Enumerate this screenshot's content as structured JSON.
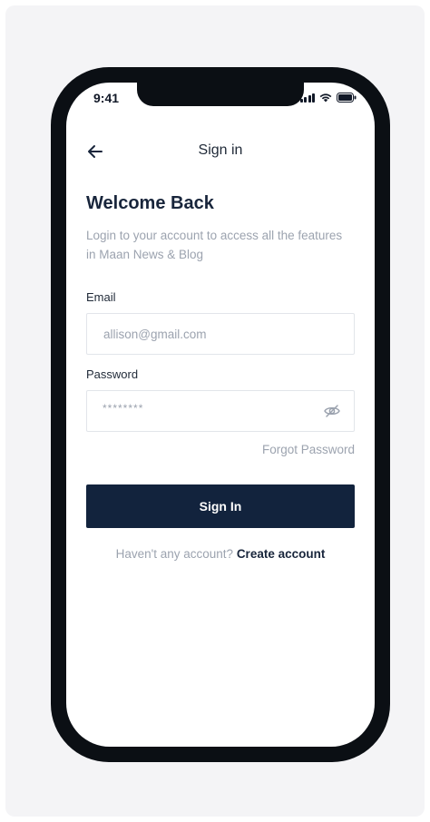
{
  "status_bar": {
    "time": "9:41"
  },
  "header": {
    "title": "Sign in"
  },
  "welcome": {
    "heading": "Welcome Back",
    "subtitle": "Login to your account to access all the features in Maan News & Blog"
  },
  "form": {
    "email_label": "Email",
    "email_value": "allison@gmail.com",
    "password_label": "Password",
    "password_value": "********",
    "forgot_label": "Forgot Password",
    "submit_label": "Sign In"
  },
  "footer": {
    "prompt": "Haven't any account?",
    "link": "Create account"
  },
  "colors": {
    "primary": "#12233d",
    "muted_text": "#9ca3af",
    "heading": "#18253b"
  }
}
